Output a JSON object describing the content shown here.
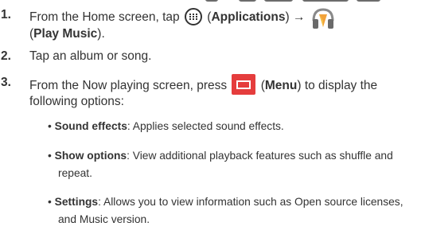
{
  "steps": [
    {
      "number": "1.",
      "line1_before": "From the Home screen, tap",
      "apps_label": "Applications",
      "arrow": "→",
      "line2_label": "Play Music",
      "line2_after": ")."
    },
    {
      "number": "2.",
      "text": "Tap an album or song."
    },
    {
      "number": "3.",
      "line1_before": "From the Now playing screen, press",
      "menu_label": "Menu",
      "line1_after": ") to display the",
      "line2": "following options:"
    }
  ],
  "options": [
    {
      "name": "Sound effects",
      "desc": ": Applies selected sound effects."
    },
    {
      "name": "Show options",
      "desc": ": View additional playback features such as shuffle and",
      "cont": "repeat."
    },
    {
      "name": "Settings",
      "desc": ": Allows you to view information such as Open source licenses,",
      "cont": "and Music version."
    }
  ],
  "icons": {
    "apps": "applications-grid-icon",
    "music": "headphones-icon",
    "menu": "menu-icon",
    "accent": "#e53d3d"
  }
}
